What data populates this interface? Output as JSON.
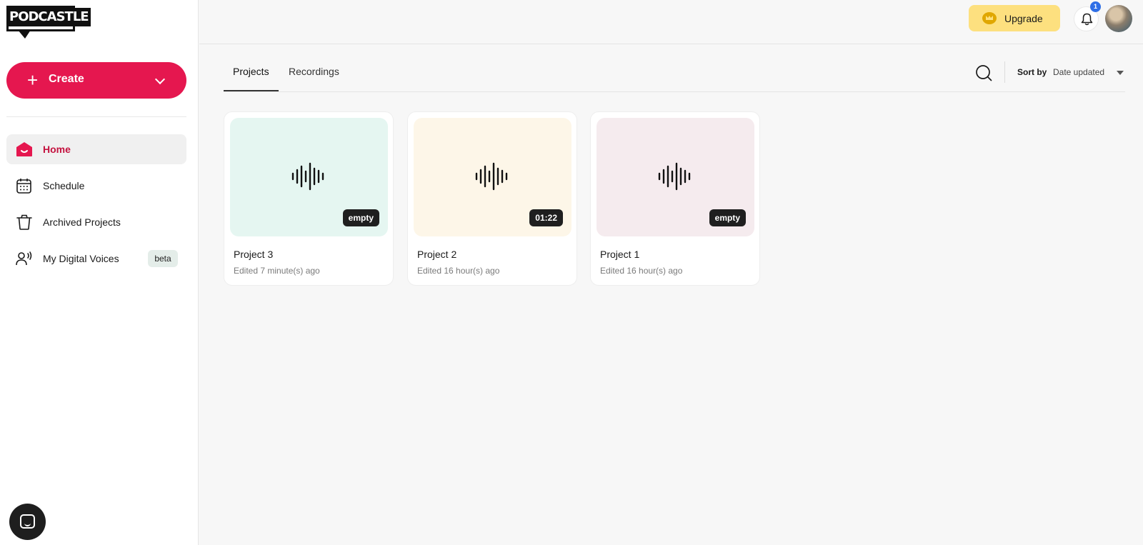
{
  "app": {
    "logo_text": "PODCASTLE"
  },
  "sidebar": {
    "create_label": "Create",
    "items": [
      {
        "label": "Home",
        "icon": "home-icon",
        "active": true
      },
      {
        "label": "Schedule",
        "icon": "calendar-icon"
      },
      {
        "label": "Archived Projects",
        "icon": "trash-icon"
      },
      {
        "label": "My Digital Voices",
        "icon": "voice-user-icon",
        "badge": "beta"
      }
    ]
  },
  "header": {
    "upgrade_label": "Upgrade",
    "notification_count": "1"
  },
  "tabs": {
    "items": [
      "Projects",
      "Recordings"
    ],
    "active": "Projects",
    "sort_by_label": "Sort by",
    "sort_value": "Date updated"
  },
  "projects": [
    {
      "title": "Project 3",
      "edited": "Edited 7 minute(s) ago",
      "badge": "empty",
      "color": "#e5f6f1"
    },
    {
      "title": "Project 2",
      "edited": "Edited 16 hour(s) ago",
      "badge": "01:22",
      "color": "#fdf6e8"
    },
    {
      "title": "Project 1",
      "edited": "Edited 16 hour(s) ago",
      "badge": "empty",
      "color": "#f5ebee"
    }
  ],
  "colors": {
    "accent": "#e5174f",
    "upgrade": "#fde07f",
    "notification_badge": "#2e6ee6"
  }
}
